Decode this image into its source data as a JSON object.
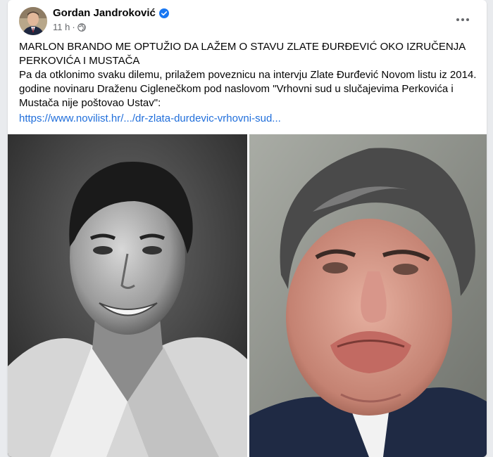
{
  "post": {
    "author": "Gordan Jandroković",
    "time": "11 h",
    "headline": "MARLON BRANDO ME OPTUŽIO DA LAŽEM O STAVU ZLATE ĐURĐEVIĆ OKO IZRUČENJA PERKOVIĆA I MUSTAČA",
    "paragraph": "Pa da otklonimo svaku dilemu, prilažem poveznicu na intervju Zlate Đurđević Novom listu iz 2014. godine novinaru Draženu Ciglenečkom pod naslovom \"Vrhovni sud u slučajevima Perkovića i Mustača nije poštovao Ustav\":",
    "link": "https://www.novilist.hr/.../dr-zlata-durdevic-vrhovni-sud...",
    "icons": {
      "verified": "verified-badge-icon",
      "privacy": "globe-icon",
      "more": "more-options-icon"
    },
    "colors": {
      "link": "#216fdb",
      "verified": "#1877f2",
      "meta": "#65676b"
    }
  }
}
